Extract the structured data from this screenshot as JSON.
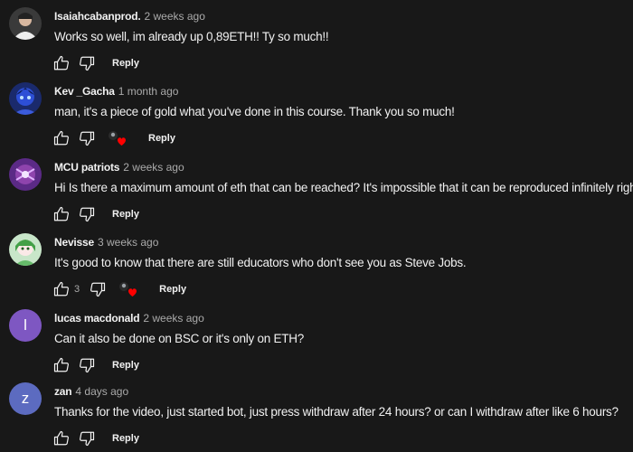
{
  "comments": [
    {
      "author": "Isaiahcabanprod.",
      "time": "2 weeks ago",
      "text": "Works so well, im already up 0,89ETH!! Ty so much!!",
      "avatar_icon": "photo-avatar",
      "reply_label": "Reply"
    },
    {
      "author": "Kev _Gacha",
      "time": "1 month ago",
      "text": "man, it's a piece of gold what you've done in this course. Thank you so much!",
      "avatar_icon": "photo-avatar",
      "creator_heart": true,
      "reply_label": "Reply"
    },
    {
      "author": "MCU patriots",
      "time": "2 weeks ago",
      "text": "Hi Is there a maximum amount of eth that can be reached? It's impossible that it can be reproduced infinitely right ?",
      "avatar_icon": "photo-avatar",
      "reply_label": "Reply"
    },
    {
      "author": "Nevisse",
      "time": "3 weeks ago",
      "text": "It's good to know that there are still educators who don't see you as Steve Jobs.",
      "avatar_icon": "photo-avatar",
      "likes": "3",
      "creator_heart": true,
      "reply_label": "Reply"
    },
    {
      "author": "lucas macdonald",
      "time": "2 weeks ago",
      "text": "Can it also be done on BSC or it's only on ETH?",
      "avatar_letter": "l",
      "avatar_color": "#7e57c2",
      "reply_label": "Reply"
    },
    {
      "author": "zan",
      "time": "4 days ago",
      "text": "Thanks for the video, just started bot, just press withdraw after 24 hours? or can I withdraw after like 6 hours?",
      "avatar_letter": "z",
      "avatar_color": "#5c6bc0",
      "reply_label": "Reply"
    }
  ],
  "colors": {
    "background": "#181818",
    "text_primary": "#f1f1f1",
    "text_secondary": "#aaaaaa",
    "heart": "#ff0000"
  }
}
